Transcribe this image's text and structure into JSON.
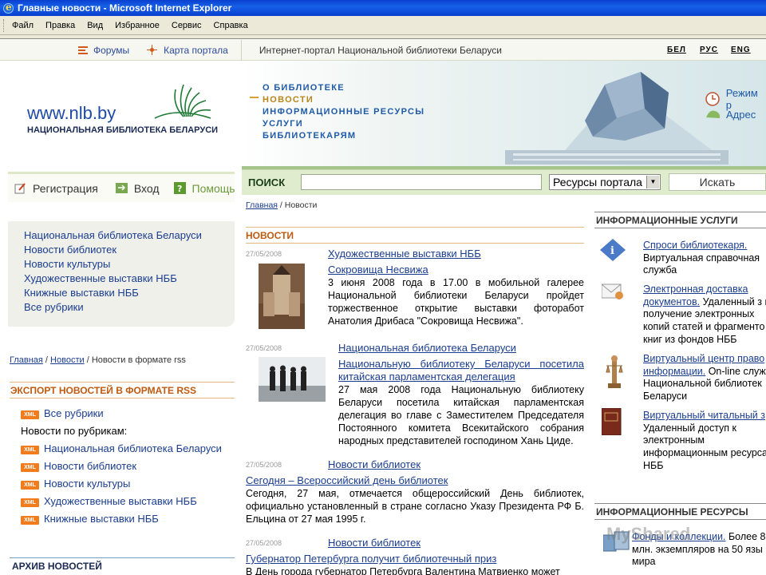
{
  "window": {
    "title": "Главные новости - Microsoft Internet Explorer"
  },
  "menu": [
    "Файл",
    "Правка",
    "Вид",
    "Избранное",
    "Сервис",
    "Справка"
  ],
  "topbar": {
    "forums": "Форумы",
    "sitemap": "Карта портала",
    "portal_title": "Интернет-портал Национальной библиотеки Беларуси",
    "langs": [
      "БЕЛ",
      "РУС",
      "ENG"
    ]
  },
  "logo": {
    "url": "www.nlb.by",
    "subtitle": "НАЦИОНАЛЬНАЯ БИБЛИОТЕКА БЕЛАРУСИ"
  },
  "nav": [
    "О БИБЛИОТЕКЕ",
    "НОВОСТИ",
    "ИНФОРМАЦИОННЫЕ РЕСУРСЫ",
    "УСЛУГИ",
    "БИБЛИОТЕКАРЯМ"
  ],
  "side_links": [
    "Режим р",
    "Адрес"
  ],
  "account": {
    "register": "Регистрация",
    "login": "Вход",
    "help": "Помощь"
  },
  "rubrics": [
    "Национальная библиотека Беларуси",
    "Новости библиотек",
    "Новости культуры",
    "Художественные выставки НББ",
    "Книжные выставки НББ",
    "Все рубрики"
  ],
  "left_breadcrumb": {
    "home": "Главная",
    "news": "Новости",
    "current": "Новости в формате rss"
  },
  "rss": {
    "title": "ЭКСПОРТ НОВОСТЕЙ В ФОРМАТЕ RSS",
    "badge": "XML",
    "all": "Все рубрики",
    "by_rubric": "Новости по рубрикам:",
    "items": [
      "Национальная библиотека Беларуси",
      "Новости библиотек",
      "Новости культуры",
      "Художественные выставки НББ",
      "Книжные выставки НББ"
    ]
  },
  "archive_title": "АРХИВ НОВОСТЕЙ",
  "search": {
    "label": "ПОИСК",
    "value": "",
    "select": "Ресурсы портала",
    "button": "Искать"
  },
  "main_breadcrumb": {
    "home": "Главная",
    "current": "Новости"
  },
  "news_title": "НОВОСТИ",
  "news": [
    {
      "date": "27/05/2008",
      "rubric": "Художественные выставки НББ",
      "headline": "Сокровища Несвижа",
      "text": "3 июня 2008 года в 17.00 в мобильной галерее Национальной библиотеки Беларуси пройдет торжественное открытие выставки фоторабот Анатолия Дрибаса \"Сокровища Несвижа\"."
    },
    {
      "date": "27/05/2008",
      "rubric": "Национальная библиотека Беларуси",
      "headline": "Национальную библиотеку Беларуси посетила китайская парламентская делегация",
      "text": "27 мая 2008 года Национальную библиотеку Беларуси посетила китайская парламентская делегация во главе с Заместителем Председателя Постоянного комитета Всекитайского собрания народных представителей господином Хань Циде."
    },
    {
      "date": "27/05/2008",
      "rubric": "Новости библиотек",
      "headline": "Сегодня – Всероссийский день библиотек",
      "text": "Сегодня, 27 мая, отмечается общероссийский День библиотек, официально установленный в стране согласно Указу Президента РФ Б. Ельцина от 27 мая 1995 г."
    },
    {
      "date": "27/05/2008",
      "rubric": "Новости библиотек",
      "headline": "Губернатор Петербурга получит библиотечный приз",
      "text": "В День города губернатор Петербурга Валентина Матвиенко может"
    }
  ],
  "info_services": {
    "title": "ИНФОРМАЦИОННЫЕ УСЛУГИ",
    "items": [
      {
        "link": "Спроси библиотекаря.",
        "text": "Виртуальная справочная служба"
      },
      {
        "link": "Электронная доставка документов.",
        "text": "Удаленный з и получение электронных копий статей и фрагменто книг из фондов НББ"
      },
      {
        "link": "Виртуальный центр право информации.",
        "text": "On-line служ Национальной библиотек Беларуси"
      },
      {
        "link": "Виртуальный читальный з",
        "text": "Удаленный доступ к электронным информационным ресурса НББ"
      }
    ]
  },
  "info_resources": {
    "title": "ИНФОРМАЦИОННЫЕ РЕСУРСЫ",
    "item": {
      "link": "Фонды и коллекции.",
      "text": "Более 8 млн. экземпляров на 50 язы мира"
    }
  },
  "watermark": "MyShared"
}
